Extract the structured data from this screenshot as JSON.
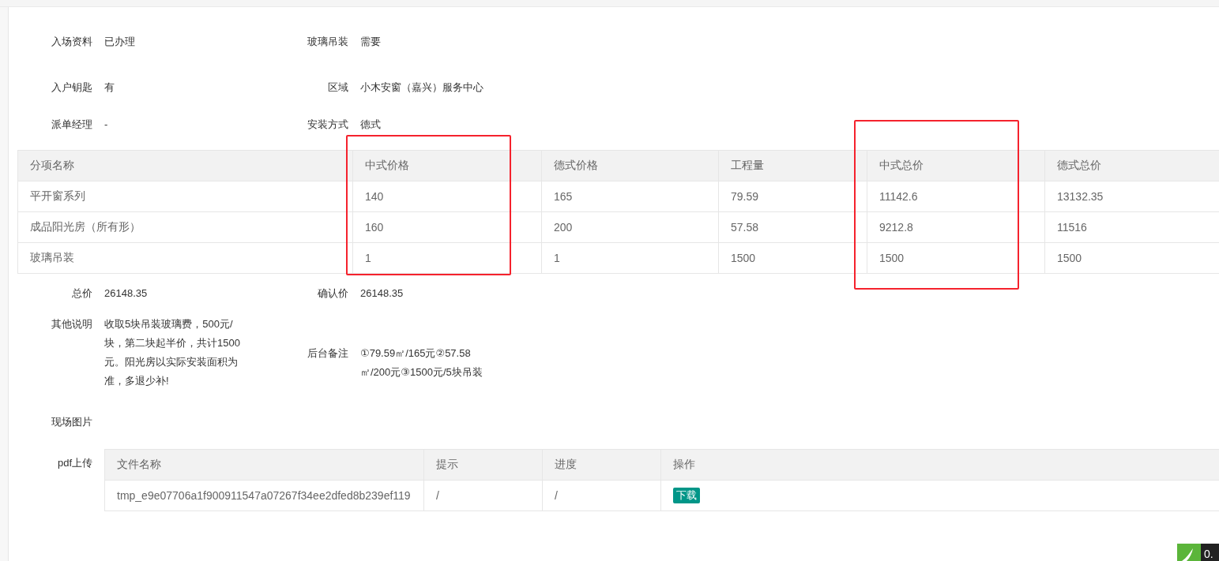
{
  "info_rows": [
    {
      "left": {
        "label": "入场资料",
        "value": "已办理"
      },
      "right": {
        "label": "玻璃吊装",
        "value": "需要"
      }
    },
    {
      "left": {
        "label": "入户钥匙",
        "value": "有"
      },
      "right": {
        "label": "区域",
        "value": "小木安窗（嘉兴）服务中心"
      }
    },
    {
      "left": {
        "label": "派单经理",
        "value": "-"
      },
      "right": {
        "label": "安装方式",
        "value": "德式"
      }
    }
  ],
  "price_table": {
    "columns": [
      {
        "label": "分项名称",
        "highlighted": false
      },
      {
        "label": "中式价格",
        "highlighted": true
      },
      {
        "label": "德式价格",
        "highlighted": false
      },
      {
        "label": "工程量",
        "highlighted": false
      },
      {
        "label": "中式总价",
        "highlighted": true
      },
      {
        "label": "德式总价",
        "highlighted": false
      }
    ],
    "rows": [
      [
        "平开窗系列",
        "140",
        "165",
        "79.59",
        "11142.6",
        "13132.35"
      ],
      [
        "成品阳光房（所有形）",
        "160",
        "200",
        "57.58",
        "9212.8",
        "11516"
      ],
      [
        "玻璃吊装",
        "1",
        "1",
        "1500",
        "1500",
        "1500"
      ]
    ]
  },
  "totals": {
    "left": {
      "label": "总价",
      "value": "26148.35"
    },
    "right": {
      "label": "确认价",
      "value": "26148.35"
    }
  },
  "notes": {
    "left": {
      "label": "其他说明",
      "value": "收取5块吊装玻璃费，500元/块，第二块起半价，共计1500元。阳光房以实际安装面积为准，多退少补!"
    },
    "right": {
      "label": "后台备注",
      "value": "①79.59㎡/165元②57.58㎡/200元③1500元/5块吊装"
    }
  },
  "photos": {
    "label": "现场图片"
  },
  "pdf_upload": {
    "label": "pdf上传",
    "columns": [
      "文件名称",
      "提示",
      "进度",
      "操作"
    ],
    "rows": [
      {
        "file_name": "tmp_e9e07706a1f900911547a07267f34ee2dfed8b239ef119",
        "hint": "/",
        "progress": "/",
        "action": "下载"
      }
    ]
  },
  "corner_widget": {
    "text": "0."
  }
}
